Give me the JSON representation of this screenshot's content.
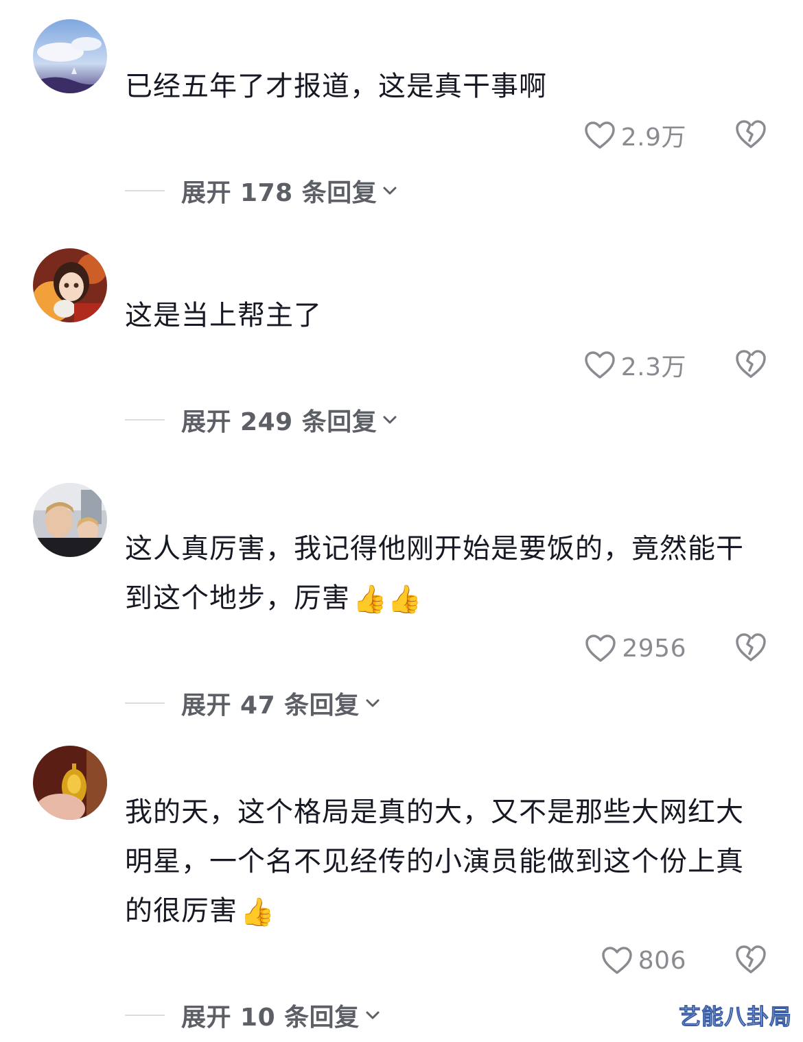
{
  "comments": [
    {
      "text": "已经五年了才报道，这是真干事啊",
      "likes": "2.9万",
      "replies": "展开 178 条回复"
    },
    {
      "text": "这是当上帮主了",
      "likes": "2.3万",
      "replies": "展开 249 条回复"
    },
    {
      "text": "这人真厉害，我记得他刚开始是要饭的，竟然能干到这个地步，厉害",
      "emoji": "👍👍",
      "likes": "2956",
      "replies": "展开 47 条回复"
    },
    {
      "text": "我的天，这个格局是真的大，又不是那些大网红大明星，一个名不见经传的小演员能做到这个份上真的很厉害",
      "emoji": "👍",
      "likes": "806",
      "replies": "展开 10 条回复"
    }
  ],
  "watermark": "艺能八卦局",
  "colors": {
    "text": "#161823",
    "meta": "#8a8b91",
    "replies": "#5d5f66",
    "divider": "#dcdcdf"
  },
  "icons": {
    "like": "heart-outline-icon",
    "dislike": "broken-heart-icon",
    "expand": "chevron-down-icon"
  }
}
